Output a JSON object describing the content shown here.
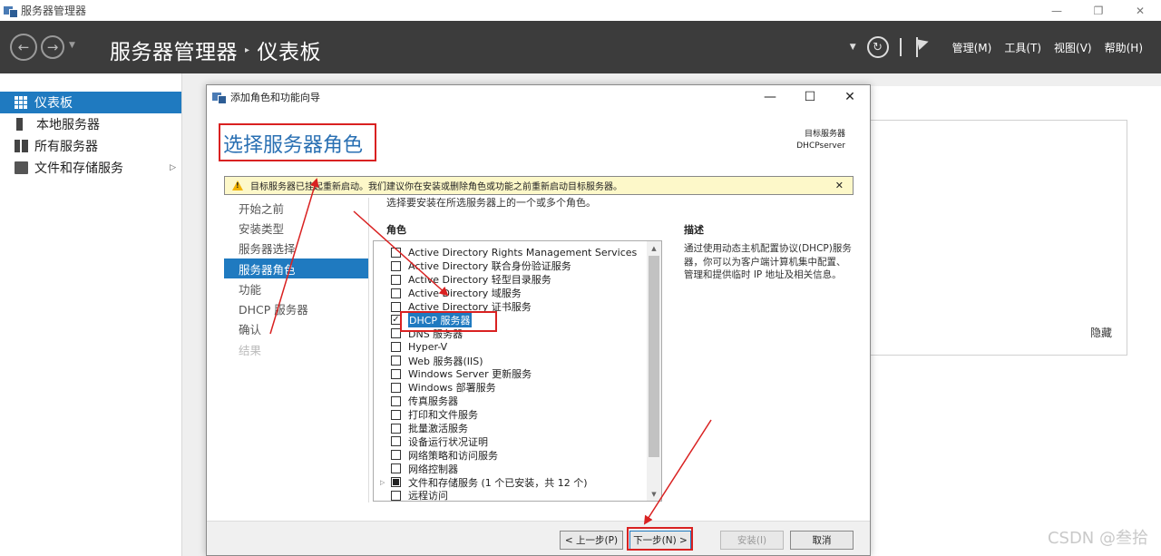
{
  "window": {
    "title": "服务器管理器"
  },
  "header": {
    "breadcrumb_root": "服务器管理器",
    "breadcrumb_current": "仪表板",
    "menus": [
      "管理(M)",
      "工具(T)",
      "视图(V)",
      "帮助(H)"
    ]
  },
  "sidebar": {
    "items": [
      {
        "label": "仪表板",
        "icon": "dashboard-icon",
        "active": true
      },
      {
        "label": "本地服务器",
        "icon": "server-icon"
      },
      {
        "label": "所有服务器",
        "icon": "servers-icon"
      },
      {
        "label": "文件和存储服务",
        "icon": "storage-icon",
        "expandable": true
      }
    ]
  },
  "background": {
    "hide_label": "隐藏"
  },
  "wizard": {
    "title": "添加角色和功能向导",
    "heading": "选择服务器角色",
    "target_label": "目标服务器",
    "target_server": "DHCPserver",
    "warning": "目标服务器已挂起重新启动。我们建议你在安装或删除角色或功能之前重新启动目标服务器。",
    "steps": [
      {
        "label": "开始之前",
        "state": "normal"
      },
      {
        "label": "安装类型",
        "state": "normal"
      },
      {
        "label": "服务器选择",
        "state": "normal"
      },
      {
        "label": "服务器角色",
        "state": "active"
      },
      {
        "label": "功能",
        "state": "normal"
      },
      {
        "label": "DHCP 服务器",
        "state": "normal"
      },
      {
        "label": "确认",
        "state": "normal"
      },
      {
        "label": "结果",
        "state": "disabled"
      }
    ],
    "intro": "选择要安装在所选服务器上的一个或多个角色。",
    "roles_heading": "角色",
    "roles": [
      {
        "label": "Active Directory Rights Management Services",
        "checked": false
      },
      {
        "label": "Active Directory 联合身份验证服务",
        "checked": false
      },
      {
        "label": "Active Directory 轻型目录服务",
        "checked": false
      },
      {
        "label": "Active Directory 域服务",
        "checked": false
      },
      {
        "label": "Active Directory 证书服务",
        "checked": false
      },
      {
        "label": "DHCP 服务器",
        "checked": true,
        "selected": true
      },
      {
        "label": "DNS 服务器",
        "checked": false
      },
      {
        "label": "Hyper-V",
        "checked": false
      },
      {
        "label": "Web 服务器(IIS)",
        "checked": false
      },
      {
        "label": "Windows Server 更新服务",
        "checked": false
      },
      {
        "label": "Windows 部署服务",
        "checked": false
      },
      {
        "label": "传真服务器",
        "checked": false
      },
      {
        "label": "打印和文件服务",
        "checked": false
      },
      {
        "label": "批量激活服务",
        "checked": false
      },
      {
        "label": "设备运行状况证明",
        "checked": false
      },
      {
        "label": "网络策略和访问服务",
        "checked": false
      },
      {
        "label": "网络控制器",
        "checked": false
      },
      {
        "label": "文件和存储服务 (1 个已安装，共 12 个)",
        "checked": "partial",
        "expandable": true
      },
      {
        "label": "远程访问",
        "checked": false
      }
    ],
    "description_heading": "描述",
    "description": "通过使用动态主机配置协议(DHCP)服务器，你可以为客户端计算机集中配置、管理和提供临时 IP 地址及相关信息。",
    "buttons": {
      "prev": "< 上一步(P)",
      "next": "下一步(N) >",
      "install": "安装(I)",
      "cancel": "取消"
    }
  },
  "watermark": "CSDN @叁拾",
  "colors": {
    "accent": "#1f7ac0",
    "annotation": "#d92121",
    "header_bg": "#3c3c3c"
  }
}
